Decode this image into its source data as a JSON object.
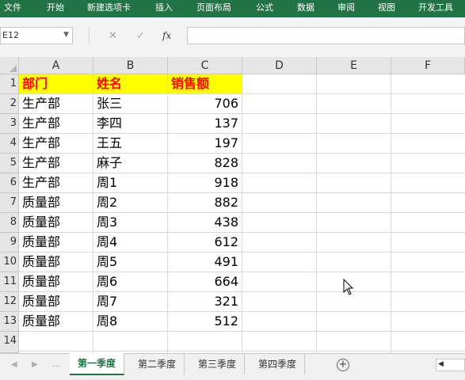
{
  "ribbon": {
    "tabs": [
      "文件",
      "开始",
      "新建选项卡",
      "插入",
      "页面布局",
      "公式",
      "数据",
      "审阅",
      "视图",
      "开发工具"
    ]
  },
  "formula_bar": {
    "name_box": "E12",
    "cancel_icon": "✕",
    "enter_icon": "✓",
    "fx_label": "fx",
    "formula_value": ""
  },
  "columns": [
    "A",
    "B",
    "C",
    "D",
    "E",
    "F"
  ],
  "rows": [
    "1",
    "2",
    "3",
    "4",
    "5",
    "6",
    "7",
    "8",
    "9",
    "10",
    "11",
    "12",
    "13",
    "14"
  ],
  "sheet": {
    "header": [
      "部门",
      "姓名",
      "销售额"
    ],
    "data": [
      [
        "生产部",
        "张三",
        "706"
      ],
      [
        "生产部",
        "李四",
        "137"
      ],
      [
        "生产部",
        "王五",
        "197"
      ],
      [
        "生产部",
        "麻子",
        "828"
      ],
      [
        "生产部",
        "周1",
        "918"
      ],
      [
        "质量部",
        "周2",
        "882"
      ],
      [
        "质量部",
        "周3",
        "438"
      ],
      [
        "质量部",
        "周4",
        "612"
      ],
      [
        "质量部",
        "周5",
        "491"
      ],
      [
        "质量部",
        "周6",
        "664"
      ],
      [
        "质量部",
        "周7",
        "321"
      ],
      [
        "质量部",
        "周8",
        "512"
      ]
    ]
  },
  "sheet_tabs": [
    "第一季度",
    "第二季度",
    "第三季度",
    "第四季度"
  ],
  "active_sheet": "第一季度",
  "add_sheet_icon": "+",
  "colors": {
    "ribbon_bg": "#217346",
    "header_fill": "#ffff00",
    "header_text": "#ff0000"
  }
}
